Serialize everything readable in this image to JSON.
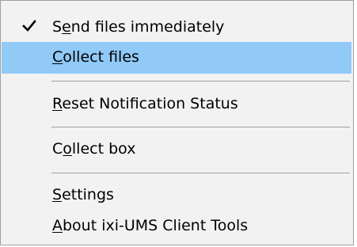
{
  "menu": {
    "items": [
      {
        "pre": "S",
        "acc": "e",
        "post": "nd files immediately",
        "checked": true,
        "highlighted": false
      },
      {
        "pre": "",
        "acc": "C",
        "post": "ollect files",
        "checked": false,
        "highlighted": true
      },
      {
        "pre": "",
        "acc": "R",
        "post": "eset Notification Status",
        "checked": false,
        "highlighted": false
      },
      {
        "pre": "C",
        "acc": "o",
        "post": "llect box",
        "checked": false,
        "highlighted": false
      },
      {
        "pre": "",
        "acc": "S",
        "post": "ettings",
        "checked": false,
        "highlighted": false
      },
      {
        "pre": "",
        "acc": "A",
        "post": "bout ixi-UMS Client Tools",
        "checked": false,
        "highlighted": false
      }
    ],
    "check_icon": "checkmark-icon",
    "highlight_color": "#91c9f7",
    "background_color": "#f2f2f2"
  }
}
